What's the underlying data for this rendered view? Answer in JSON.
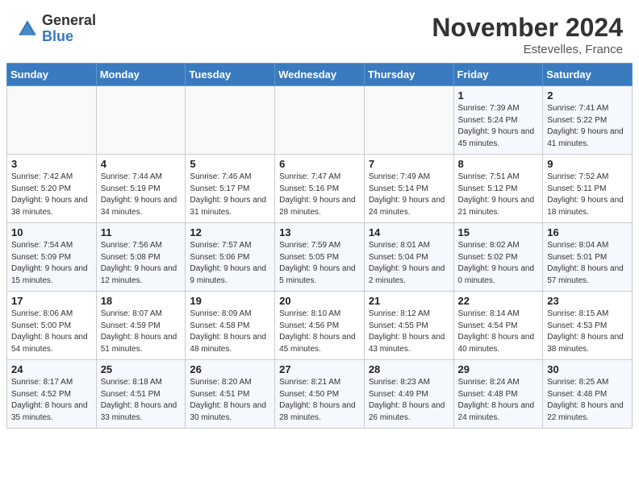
{
  "header": {
    "logo_general": "General",
    "logo_blue": "Blue",
    "month_year": "November 2024",
    "location": "Estevelles, France"
  },
  "days_of_week": [
    "Sunday",
    "Monday",
    "Tuesday",
    "Wednesday",
    "Thursday",
    "Friday",
    "Saturday"
  ],
  "weeks": [
    [
      {
        "day": "",
        "info": ""
      },
      {
        "day": "",
        "info": ""
      },
      {
        "day": "",
        "info": ""
      },
      {
        "day": "",
        "info": ""
      },
      {
        "day": "",
        "info": ""
      },
      {
        "day": "1",
        "info": "Sunrise: 7:39 AM\nSunset: 5:24 PM\nDaylight: 9 hours and 45 minutes."
      },
      {
        "day": "2",
        "info": "Sunrise: 7:41 AM\nSunset: 5:22 PM\nDaylight: 9 hours and 41 minutes."
      }
    ],
    [
      {
        "day": "3",
        "info": "Sunrise: 7:42 AM\nSunset: 5:20 PM\nDaylight: 9 hours and 38 minutes."
      },
      {
        "day": "4",
        "info": "Sunrise: 7:44 AM\nSunset: 5:19 PM\nDaylight: 9 hours and 34 minutes."
      },
      {
        "day": "5",
        "info": "Sunrise: 7:46 AM\nSunset: 5:17 PM\nDaylight: 9 hours and 31 minutes."
      },
      {
        "day": "6",
        "info": "Sunrise: 7:47 AM\nSunset: 5:16 PM\nDaylight: 9 hours and 28 minutes."
      },
      {
        "day": "7",
        "info": "Sunrise: 7:49 AM\nSunset: 5:14 PM\nDaylight: 9 hours and 24 minutes."
      },
      {
        "day": "8",
        "info": "Sunrise: 7:51 AM\nSunset: 5:12 PM\nDaylight: 9 hours and 21 minutes."
      },
      {
        "day": "9",
        "info": "Sunrise: 7:52 AM\nSunset: 5:11 PM\nDaylight: 9 hours and 18 minutes."
      }
    ],
    [
      {
        "day": "10",
        "info": "Sunrise: 7:54 AM\nSunset: 5:09 PM\nDaylight: 9 hours and 15 minutes."
      },
      {
        "day": "11",
        "info": "Sunrise: 7:56 AM\nSunset: 5:08 PM\nDaylight: 9 hours and 12 minutes."
      },
      {
        "day": "12",
        "info": "Sunrise: 7:57 AM\nSunset: 5:06 PM\nDaylight: 9 hours and 9 minutes."
      },
      {
        "day": "13",
        "info": "Sunrise: 7:59 AM\nSunset: 5:05 PM\nDaylight: 9 hours and 5 minutes."
      },
      {
        "day": "14",
        "info": "Sunrise: 8:01 AM\nSunset: 5:04 PM\nDaylight: 9 hours and 2 minutes."
      },
      {
        "day": "15",
        "info": "Sunrise: 8:02 AM\nSunset: 5:02 PM\nDaylight: 9 hours and 0 minutes."
      },
      {
        "day": "16",
        "info": "Sunrise: 8:04 AM\nSunset: 5:01 PM\nDaylight: 8 hours and 57 minutes."
      }
    ],
    [
      {
        "day": "17",
        "info": "Sunrise: 8:06 AM\nSunset: 5:00 PM\nDaylight: 8 hours and 54 minutes."
      },
      {
        "day": "18",
        "info": "Sunrise: 8:07 AM\nSunset: 4:59 PM\nDaylight: 8 hours and 51 minutes."
      },
      {
        "day": "19",
        "info": "Sunrise: 8:09 AM\nSunset: 4:58 PM\nDaylight: 8 hours and 48 minutes."
      },
      {
        "day": "20",
        "info": "Sunrise: 8:10 AM\nSunset: 4:56 PM\nDaylight: 8 hours and 45 minutes."
      },
      {
        "day": "21",
        "info": "Sunrise: 8:12 AM\nSunset: 4:55 PM\nDaylight: 8 hours and 43 minutes."
      },
      {
        "day": "22",
        "info": "Sunrise: 8:14 AM\nSunset: 4:54 PM\nDaylight: 8 hours and 40 minutes."
      },
      {
        "day": "23",
        "info": "Sunrise: 8:15 AM\nSunset: 4:53 PM\nDaylight: 8 hours and 38 minutes."
      }
    ],
    [
      {
        "day": "24",
        "info": "Sunrise: 8:17 AM\nSunset: 4:52 PM\nDaylight: 8 hours and 35 minutes."
      },
      {
        "day": "25",
        "info": "Sunrise: 8:18 AM\nSunset: 4:51 PM\nDaylight: 8 hours and 33 minutes."
      },
      {
        "day": "26",
        "info": "Sunrise: 8:20 AM\nSunset: 4:51 PM\nDaylight: 8 hours and 30 minutes."
      },
      {
        "day": "27",
        "info": "Sunrise: 8:21 AM\nSunset: 4:50 PM\nDaylight: 8 hours and 28 minutes."
      },
      {
        "day": "28",
        "info": "Sunrise: 8:23 AM\nSunset: 4:49 PM\nDaylight: 8 hours and 26 minutes."
      },
      {
        "day": "29",
        "info": "Sunrise: 8:24 AM\nSunset: 4:48 PM\nDaylight: 8 hours and 24 minutes."
      },
      {
        "day": "30",
        "info": "Sunrise: 8:25 AM\nSunset: 4:48 PM\nDaylight: 8 hours and 22 minutes."
      }
    ]
  ]
}
